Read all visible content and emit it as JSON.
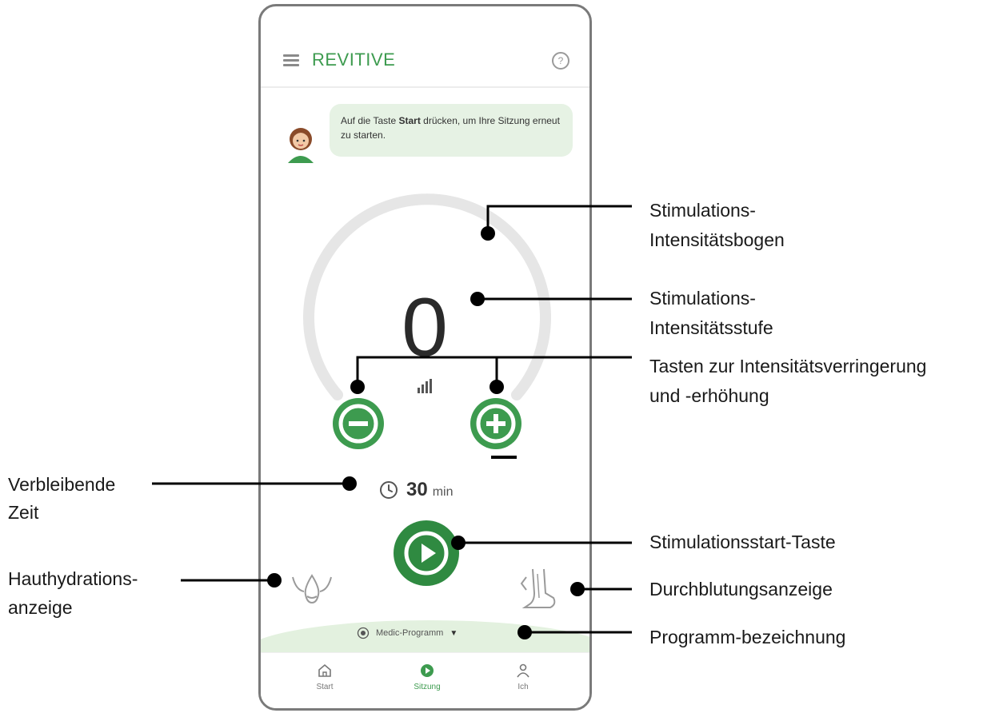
{
  "app": {
    "brand": "REVITIVE",
    "help_icon": "help-circle-icon",
    "menu_icon": "hamburger-menu-icon"
  },
  "message": {
    "pre": "Auf die Taste ",
    "bold": "Start",
    "post": " drücken, um Ihre Sitzung erneut zu starten."
  },
  "stimulation": {
    "intensity_value": "0",
    "arc_level": 0,
    "decrease_icon": "minus-icon",
    "increase_icon": "plus-icon"
  },
  "timer": {
    "value": "30",
    "unit": "min"
  },
  "program": {
    "name": "Medic-Programm"
  },
  "nav": {
    "items": [
      {
        "label": "Start",
        "icon": "home-icon"
      },
      {
        "label": "Sitzung",
        "icon": "play-circle-icon"
      },
      {
        "label": "Ich",
        "icon": "person-icon"
      }
    ]
  },
  "colors": {
    "brand_green": "#3d9b4f",
    "play_green": "#2f8a41",
    "bubble_bg": "#e6f2e4",
    "arc_track": "#e6e6e6"
  },
  "annotations": {
    "arc_1": "Stimulations-",
    "arc_2": "Intensitätsbogen",
    "level_1": "Stimulations-",
    "level_2": "Intensitätsstufe",
    "buttons_1": "Tasten zur Intensitätsverringerung",
    "buttons_2": "und -erhöhung",
    "time_1": "Verbleibende",
    "time_2": "Zeit",
    "start": "Stimulationsstart-Taste",
    "hydration_1": "Hauthydrations-",
    "hydration_2": "anzeige",
    "circulation": "Durchblutungsanzeige",
    "program": "Programm-bezeichnung"
  }
}
